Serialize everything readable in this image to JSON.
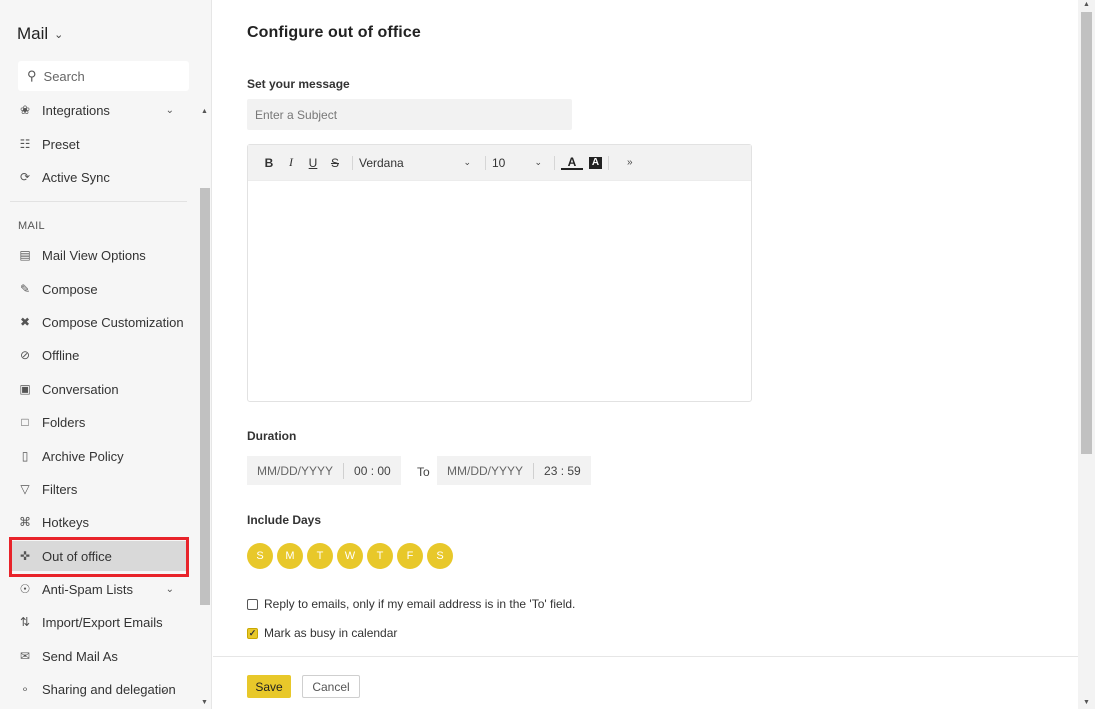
{
  "app": {
    "title": "Mail"
  },
  "search": {
    "placeholder": "Search"
  },
  "sidebar": {
    "top_items": [
      {
        "label": "Integrations",
        "icon": "plug-icon"
      },
      {
        "label": "Preset",
        "icon": "sliders-icon"
      },
      {
        "label": "Active Sync",
        "icon": "sync-icon"
      }
    ],
    "section_label": "MAIL",
    "items": [
      {
        "label": "Mail View Options",
        "icon": "layout-icon"
      },
      {
        "label": "Compose",
        "icon": "edit-icon"
      },
      {
        "label": "Compose Customization",
        "icon": "tools-icon"
      },
      {
        "label": "Offline",
        "icon": "offline-icon"
      },
      {
        "label": "Conversation",
        "icon": "conversation-icon"
      },
      {
        "label": "Folders",
        "icon": "folder-icon"
      },
      {
        "label": "Archive Policy",
        "icon": "archive-icon"
      },
      {
        "label": "Filters",
        "icon": "filter-icon"
      },
      {
        "label": "Hotkeys",
        "icon": "command-icon"
      },
      {
        "label": "Out of office",
        "icon": "signpost-icon"
      },
      {
        "label": "Anti-Spam Lists",
        "icon": "shield-icon"
      },
      {
        "label": "Import/Export Emails",
        "icon": "import-export-icon"
      },
      {
        "label": "Send Mail As",
        "icon": "send-as-icon"
      },
      {
        "label": "Sharing and delegation",
        "icon": "share-icon"
      }
    ],
    "active_item": "Out of office"
  },
  "main": {
    "title": "Configure out of office",
    "message_label": "Set your message",
    "subject_placeholder": "Enter a Subject",
    "toolbar": {
      "bold": "B",
      "italic": "I",
      "underline": "U",
      "strike": "S",
      "font": "Verdana",
      "size": "10",
      "text_color": "A",
      "bg_color": "A"
    },
    "duration_label": "Duration",
    "from_date_placeholder": "MM/DD/YYYY",
    "from_time": "00 : 00",
    "to_label": "To",
    "to_date_placeholder": "MM/DD/YYYY",
    "to_time": "23 : 59",
    "days_label": "Include Days",
    "days": [
      "S",
      "M",
      "T",
      "W",
      "T",
      "F",
      "S"
    ],
    "reply_only_label": "Reply to emails, only if my email address is in the 'To' field.",
    "reply_only_checked": false,
    "busy_label": "Mark as busy in calendar",
    "busy_checked": true,
    "save_label": "Save",
    "cancel_label": "Cancel"
  },
  "colors": {
    "accent": "#e8c82a",
    "highlight": "#e8232a"
  }
}
